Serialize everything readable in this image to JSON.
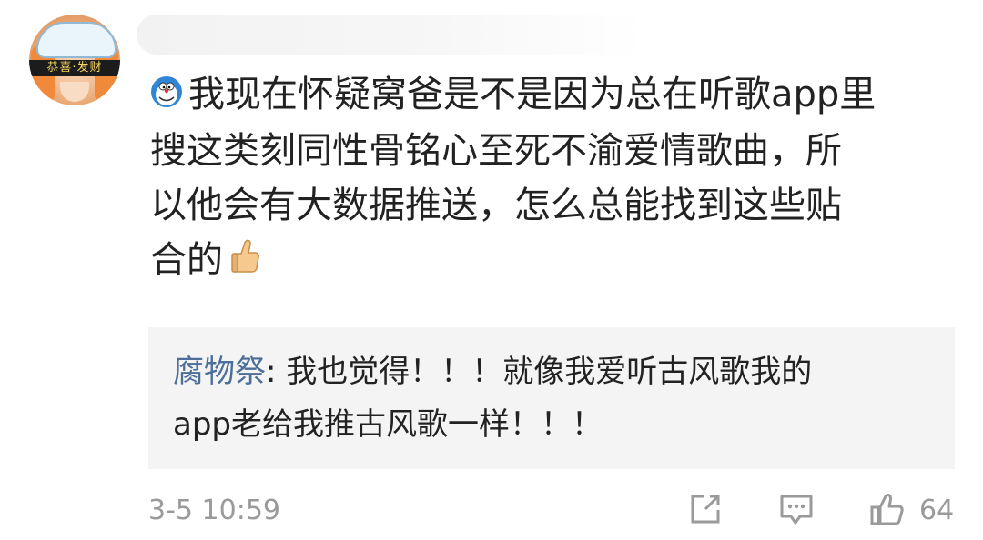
{
  "avatar": {
    "badge_text": "恭喜·发财"
  },
  "comment": {
    "line1": "我现在怀疑窝爸是不是因为总在听歌app里",
    "line2": "搜这类刻同性骨铭心至死不渝爱情歌曲，所",
    "line3": "以他会有大数据推送，怎么总能找到这些贴",
    "line4": "合的"
  },
  "reply": {
    "author": "腐物祭",
    "separator": ": ",
    "line1_text": "我也觉得！！！就像我爱听古风歌我的",
    "line2_text": "app老给我推古风歌一样！！！"
  },
  "meta": {
    "timestamp": "3-5 10:59",
    "like_count": "64"
  },
  "icons": [
    "doraemon-emoji-icon",
    "thumbs-up-emoji-icon",
    "share-icon",
    "comment-icon",
    "like-icon"
  ]
}
